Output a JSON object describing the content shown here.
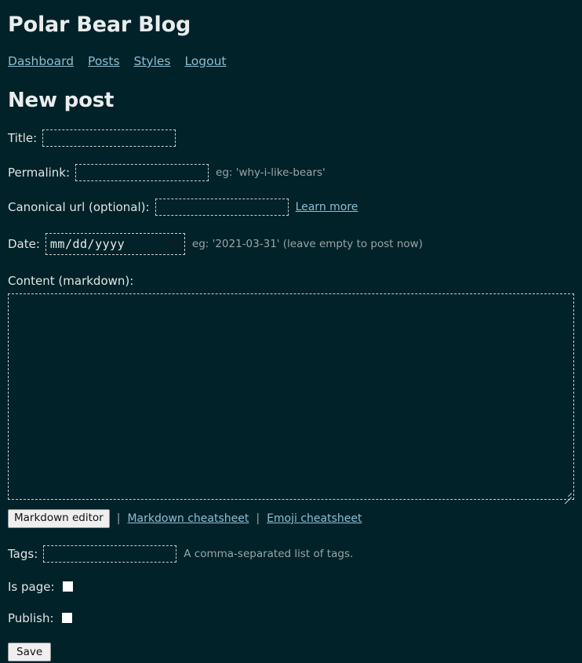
{
  "site": {
    "title": "Polar Bear Blog"
  },
  "nav": {
    "items": [
      {
        "label": "Dashboard"
      },
      {
        "label": "Posts"
      },
      {
        "label": "Styles"
      },
      {
        "label": "Logout"
      }
    ]
  },
  "page": {
    "heading": "New post"
  },
  "form": {
    "title": {
      "label": "Title:",
      "value": ""
    },
    "permalink": {
      "label": "Permalink:",
      "value": "",
      "hint": "eg: 'why-i-like-bears'"
    },
    "canonical": {
      "label": "Canonical url (optional):",
      "value": "",
      "learn_more": "Learn more"
    },
    "date": {
      "label": "Date:",
      "value": "mm/dd/yyyy",
      "hint": "eg: '2021-03-31' (leave empty to post now)",
      "picker_icon": "calendar-icon"
    },
    "content": {
      "label": "Content (markdown):",
      "value": ""
    },
    "editor_toolbar": {
      "editor_button": "Markdown editor",
      "separator": "|",
      "markdown_cheatsheet": "Markdown cheatsheet",
      "emoji_cheatsheet": "Emoji cheatsheet"
    },
    "tags": {
      "label": "Tags:",
      "value": "",
      "hint": "A comma-separated list of tags."
    },
    "is_page": {
      "label": "Is page:",
      "checked": false
    },
    "publish": {
      "label": "Publish:",
      "checked": false
    },
    "save": {
      "label": "Save"
    }
  },
  "colors": {
    "background": "#012229",
    "text": "#e8ecec",
    "link": "#8ebdd0",
    "hint": "#9aa5a8",
    "field_border": "#c9cfd0",
    "button_face": "#efefef"
  }
}
